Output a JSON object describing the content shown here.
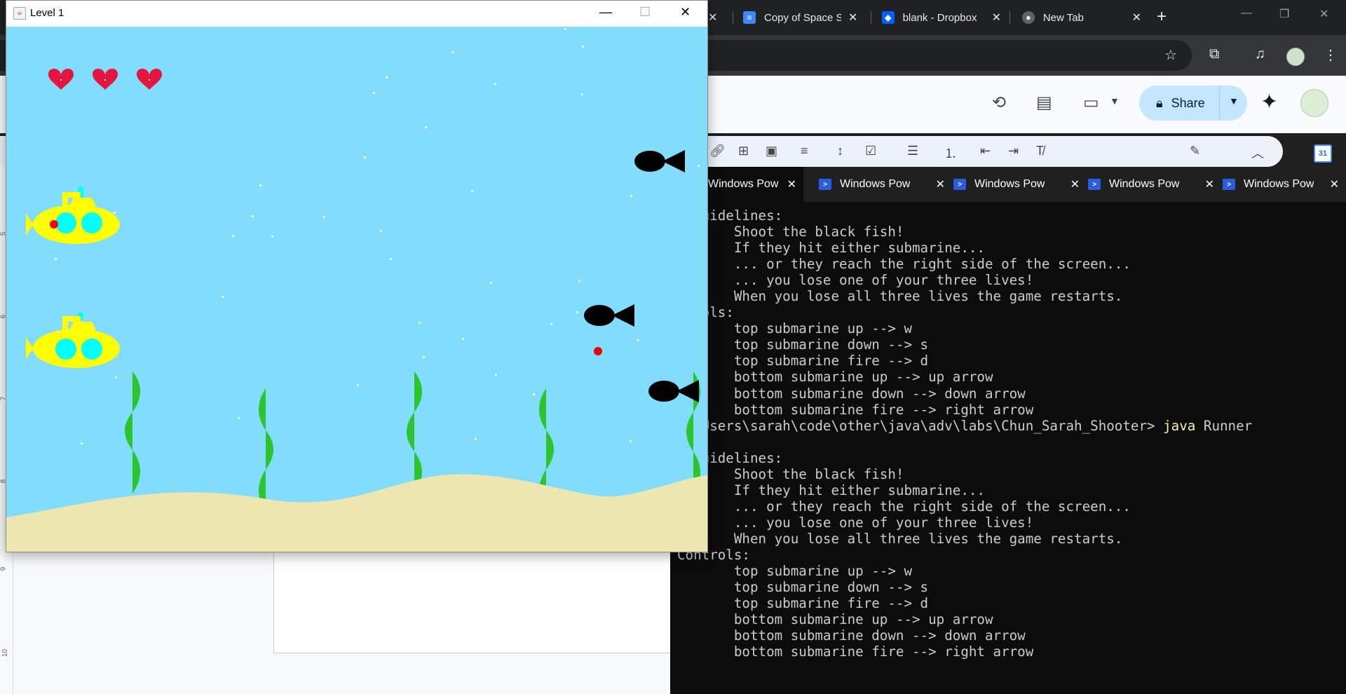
{
  "chrome": {
    "tabs": [
      {
        "title": "",
        "favicon": "doc-icon"
      },
      {
        "title": "Copy of Space Sh",
        "favicon": "docs-icon"
      },
      {
        "title": "blank - Dropbox",
        "favicon": "dropbox-icon"
      },
      {
        "title": "New Tab",
        "favicon": "chrome-icon"
      }
    ],
    "new_tab_glyph": "+",
    "window_controls": [
      "—",
      "❐",
      "✕"
    ]
  },
  "docs": {
    "share_label": "Share",
    "calendar_day": "31",
    "ruler_numbers": [
      "5",
      "6",
      "7",
      "8",
      "9",
      "10"
    ]
  },
  "terminal": {
    "tabs": [
      {
        "title": "Windows Pow",
        "active": true
      },
      {
        "title": "Windows Pow",
        "active": false
      },
      {
        "title": "Windows Pow",
        "active": false
      },
      {
        "title": "Windows Pow",
        "active": false
      },
      {
        "title": "Windows Pow",
        "active": false
      }
    ],
    "lines": [
      "e Guidelines:",
      "       Shoot the black fish!",
      "       If they hit either submarine...",
      "       ... or they reach the right side of the screen...",
      "       ... you lose one of your three lives!",
      "       When you lose all three lives the game restarts.",
      "ntrols:",
      "       top submarine up --> w",
      "       top submarine down --> s",
      "       top submarine fire --> d",
      "       bottom submarine up --> up arrow",
      "       bottom submarine down --> down arrow",
      "       bottom submarine fire --> right arrow"
    ],
    "prompt": "C:\\Users\\sarah\\code\\other\\java\\adv\\labs\\Chun_Sarah_Shooter>",
    "command": "java",
    "command_arg": "Runner",
    "lines2": [
      "",
      "e Guidelines:",
      "       Shoot the black fish!",
      "       If they hit either submarine...",
      "       ... or they reach the right side of the screen...",
      "       ... you lose one of your three lives!",
      "       When you lose all three lives the game restarts.",
      "Controls:",
      "       top submarine up --> w",
      "       top submarine down --> s",
      "       top submarine fire --> d",
      "       bottom submarine up --> up arrow",
      "       bottom submarine down --> down arrow",
      "       bottom submarine fire --> right arrow"
    ]
  },
  "game": {
    "window_title": "Level 1",
    "lives": 3,
    "colors": {
      "water": "#82dcfc",
      "sand": "#eee6b0",
      "seaweed": "#2cc52c",
      "submarine": "#ffff00",
      "porthole": "#00ffff",
      "heart": "#e3163f",
      "fish": "#000000",
      "bullet": "#ee0000"
    },
    "entities": {
      "submarines": [
        "top-submarine",
        "bottom-submarine"
      ],
      "fish_count": 3,
      "bullet_count": 2,
      "seaweed_count": 5
    }
  }
}
